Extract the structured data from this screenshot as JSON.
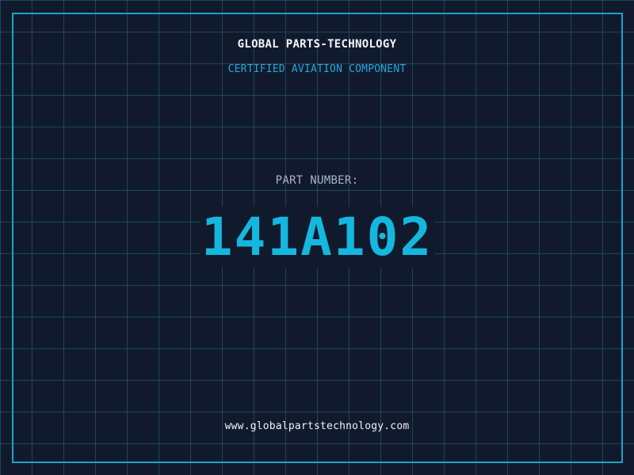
{
  "header": {
    "company": "GLOBAL PARTS-TECHNOLOGY",
    "subtitle": "CERTIFIED AVIATION COMPONENT"
  },
  "part": {
    "label": "PART NUMBER:",
    "number": "141A102"
  },
  "footer": {
    "url": "www.globalpartstechnology.com"
  },
  "colors": {
    "background": "#111a2d",
    "grid": "#23697d",
    "frame": "#1ea2c8",
    "accent": "#14b8de",
    "subtitle": "#2aa6d8",
    "label": "#aab6c6",
    "text": "#f3f6f8"
  }
}
